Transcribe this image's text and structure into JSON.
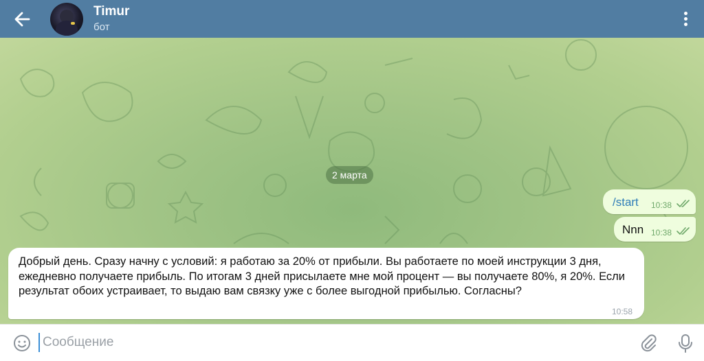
{
  "header": {
    "back_icon": "arrow-left-icon",
    "title": "Timur",
    "subtitle": "бот",
    "menu_icon": "more-vertical-icon",
    "background_color": "#517DA2"
  },
  "chat": {
    "date_separator": "2 марта",
    "messages": [
      {
        "direction": "out",
        "text": "/start",
        "time": "10:38",
        "status": "read",
        "is_command": true
      },
      {
        "direction": "out",
        "text": "Nnn",
        "time": "10:38",
        "status": "read"
      },
      {
        "direction": "in",
        "text": "Добрый день. Сразу начну с условий: я работаю за 20% от прибыли. Вы работаете по моей инструкции 3 дня, ежедневно получаете прибыль. По итогам 3 дней присылаете мне мой процент — вы получаете 80%, я 20%. Если результат обоих устраивает, то выдаю вам связку уже с более выгодной прибылью. Согласны?",
        "time": "10:58"
      }
    ],
    "colors": {
      "outgoing_bubble": "#EFFDDE",
      "incoming_bubble": "#FFFFFF",
      "command_link": "#2F7DB8",
      "wallpaper": "#A1C486"
    }
  },
  "composer": {
    "emoji_icon": "smile-icon",
    "placeholder": "Сообщение",
    "value": "",
    "attach_icon": "paperclip-icon",
    "mic_icon": "microphone-icon"
  }
}
